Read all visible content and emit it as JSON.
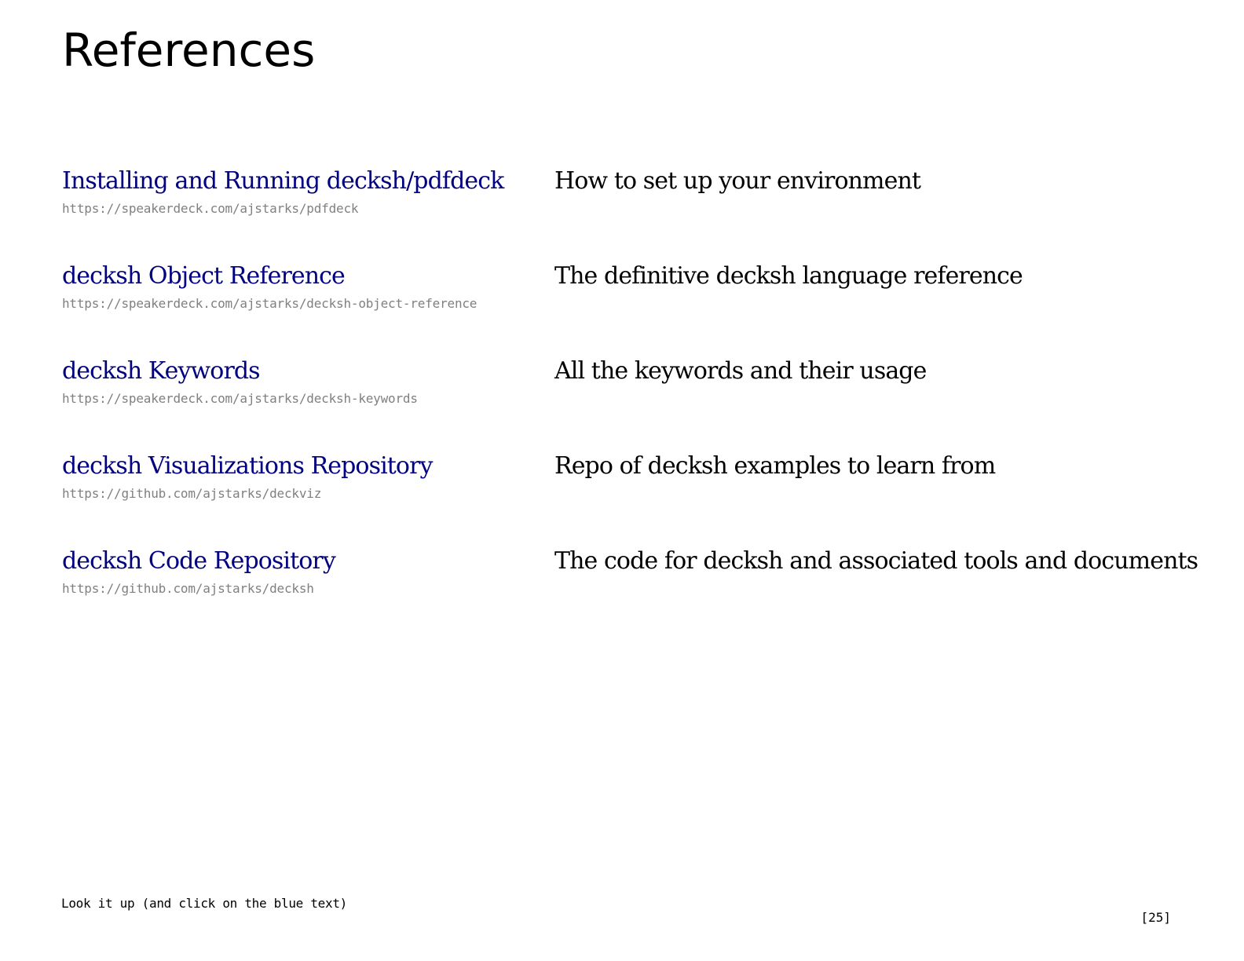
{
  "title": "References",
  "references": [
    {
      "link": "Installing and Running decksh/pdfdeck",
      "url": "https://speakerdeck.com/ajstarks/pdfdeck",
      "description": "How to set up your environment"
    },
    {
      "link": "decksh Object Reference",
      "url": "https://speakerdeck.com/ajstarks/decksh-object-reference",
      "description": "The definitive decksh language reference"
    },
    {
      "link": "decksh Keywords",
      "url": "https://speakerdeck.com/ajstarks/decksh-keywords",
      "description": "All the keywords and their usage"
    },
    {
      "link": "decksh Visualizations Repository",
      "url": "https://github.com/ajstarks/deckviz",
      "description": "Repo of decksh examples to learn from"
    },
    {
      "link": "decksh Code Repository",
      "url": "https://github.com/ajstarks/decksh",
      "description": "The code for decksh and associated tools and documents"
    }
  ],
  "footer": {
    "note": "Look it up (and click on the blue text)",
    "page_number": "[25]"
  },
  "colors": {
    "link": "#000080",
    "url": "#808080",
    "text": "#000000",
    "background": "#ffffff"
  }
}
